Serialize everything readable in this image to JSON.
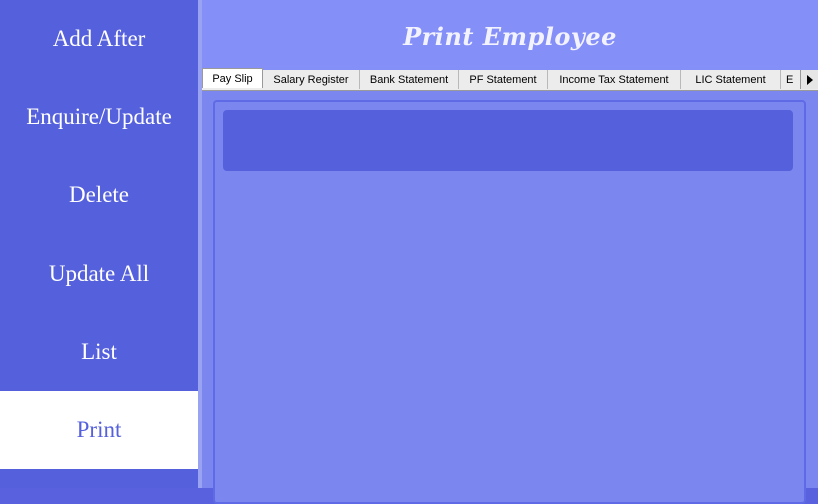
{
  "sidebar": {
    "items": [
      {
        "label": "Add After"
      },
      {
        "label": "Enquire/Update"
      },
      {
        "label": "Delete"
      },
      {
        "label": "Update All"
      },
      {
        "label": "List"
      },
      {
        "label": "Print",
        "active": true
      }
    ]
  },
  "main": {
    "title": "Print Employee",
    "tabs": [
      {
        "label": "Pay Slip",
        "active": true
      },
      {
        "label": "Salary Register"
      },
      {
        "label": "Bank Statement"
      },
      {
        "label": "PF Statement"
      },
      {
        "label": "Income Tax Statement"
      },
      {
        "label": "LIC Statement"
      },
      {
        "label": "E"
      }
    ]
  },
  "colors": {
    "sidebar": "#5560dc",
    "header": "#858ff8",
    "content": "#7b87ee",
    "active_item": "#ffffff"
  },
  "icons": {
    "tab_scroll": "triangle-right-icon"
  }
}
